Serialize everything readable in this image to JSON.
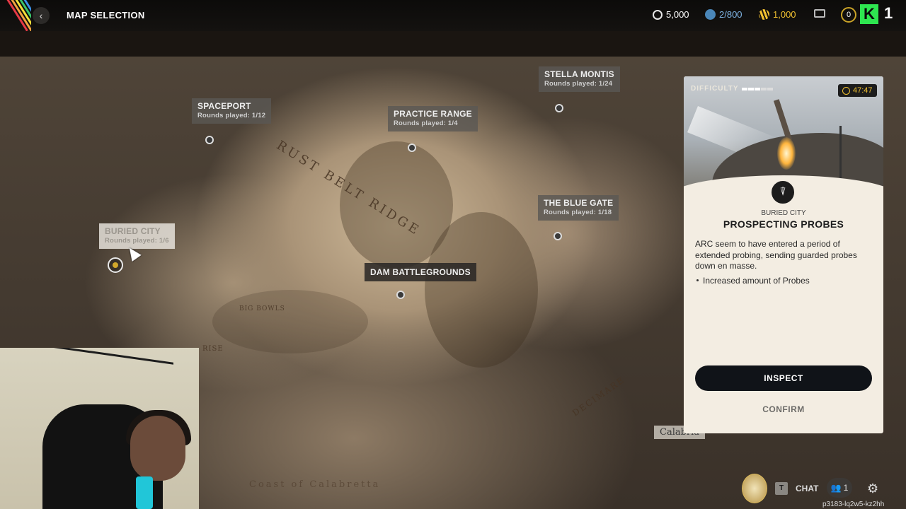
{
  "header": {
    "title": "MAP SELECTION",
    "currencies": [
      {
        "name": "coins",
        "value": "5,000",
        "color": "#e6e6e6"
      },
      {
        "name": "tokens",
        "value": "2/800",
        "color": "#7fb6e6"
      },
      {
        "name": "credits",
        "value": "1,000",
        "color": "#f2c230"
      }
    ],
    "level": "0",
    "channel_badge": "1"
  },
  "map": {
    "region_labels": [
      "RUST BELT RIDGE",
      "BIG BOWLS",
      "RISE",
      "DECIMARE",
      "Coast of Calabretta",
      "Calabria"
    ],
    "locations": [
      {
        "name": "SPACEPORT",
        "rounds": "Rounds played: 1/12"
      },
      {
        "name": "PRACTICE RANGE",
        "rounds": "Rounds played: 1/4"
      },
      {
        "name": "STELLA MONTIS",
        "rounds": "Rounds played: 1/24"
      },
      {
        "name": "THE BLUE GATE",
        "rounds": "Rounds played: 1/18"
      },
      {
        "name": "BURIED CITY",
        "rounds": "Rounds played: 1/6"
      },
      {
        "name": "DAM BATTLEGROUNDS",
        "rounds": ""
      }
    ]
  },
  "card": {
    "difficulty_label": "DIFFICULTY",
    "difficulty_level": 0.6,
    "timer": "47:47",
    "location": "BURIED CITY",
    "title": "PROSPECTING PROBES",
    "description": "ARC seem to have entered a period of extended probing, sending guarded probes down en masse.",
    "bullet": "Increased amount of Probes",
    "inspect_label": "INSPECT",
    "confirm_label": "CONFIRM"
  },
  "footer": {
    "key_hint": "T",
    "chat_label": "CHAT",
    "party_count": "1",
    "session_id": "p3183-lq2w5-kz2hh"
  },
  "colors": {
    "accent_yellow": "#f2c230",
    "button_dark": "#101318",
    "card_bg": "#f3ede2",
    "brand_green": "#2ee650"
  }
}
